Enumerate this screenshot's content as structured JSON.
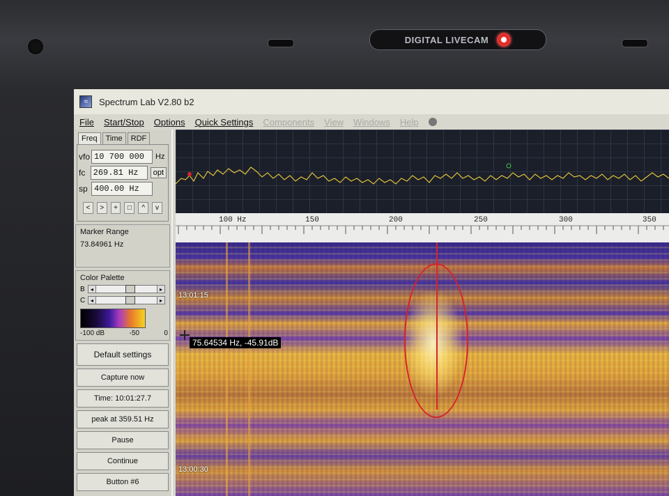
{
  "bezel": {
    "camera_label": "DIGITAL LIVECAM"
  },
  "window": {
    "title": "Spectrum Lab V2.80 b2"
  },
  "menu": [
    {
      "label": "File",
      "enabled": true
    },
    {
      "label": "Start/Stop",
      "enabled": true
    },
    {
      "label": "Options",
      "enabled": true
    },
    {
      "label": "Quick Settings",
      "enabled": true
    },
    {
      "label": "Components",
      "enabled": false
    },
    {
      "label": "View",
      "enabled": false
    },
    {
      "label": "Windows",
      "enabled": false
    },
    {
      "label": "Help",
      "enabled": false
    }
  ],
  "tabs": [
    "Freq",
    "Time",
    "RDF"
  ],
  "freq": {
    "vfo_label": "vfo",
    "vfo_value": "10 700 000",
    "vfo_unit": "Hz",
    "fc_label": "fc",
    "fc_value": "269.81 Hz",
    "fc_opt": "opt",
    "sp_label": "sp",
    "sp_value": "400.00 Hz"
  },
  "nav_buttons": [
    "<",
    ">",
    "+",
    "□",
    "^",
    "v"
  ],
  "marker_range": {
    "title": "Marker Range",
    "value": "73.84961 Hz"
  },
  "color_palette": {
    "title": "Color Palette",
    "b_label": "B",
    "c_label": "C",
    "b_level": 0.55,
    "c_level": 0.55,
    "ticks": [
      "-100 dB",
      "-50",
      "0"
    ]
  },
  "buttons": {
    "default_settings": "Default settings",
    "capture_now": "Capture now",
    "time": "Time:  10:01:27.7",
    "peak": "peak at 359.51 Hz",
    "pause": "Pause",
    "continue": "Continue",
    "button6": "Button #6"
  },
  "axis": {
    "ticks": [
      "100 Hz",
      "150",
      "200",
      "250",
      "300",
      "350"
    ]
  },
  "waterfall": {
    "time_labels": [
      "13:01:15",
      "13:00:30"
    ],
    "marker_readout": "75.64534 Hz, -45.91dB"
  },
  "colors": {
    "marker": "#d6232a",
    "trace": "#e0c23a"
  }
}
